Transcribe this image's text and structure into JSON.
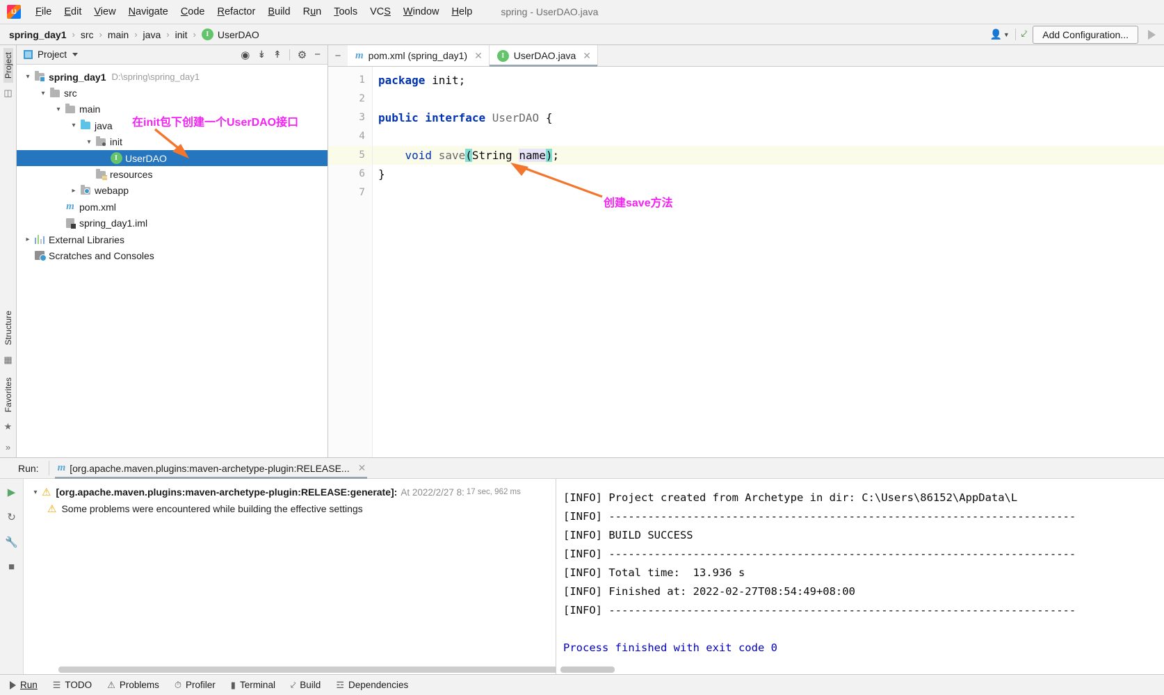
{
  "window": {
    "title": "spring - UserDAO.java",
    "app_icon": "intellij-idea-logo"
  },
  "menubar": {
    "items": [
      {
        "label": "File",
        "mnemonic": "F"
      },
      {
        "label": "Edit",
        "mnemonic": "E"
      },
      {
        "label": "View",
        "mnemonic": "V"
      },
      {
        "label": "Navigate",
        "mnemonic": "N"
      },
      {
        "label": "Code",
        "mnemonic": "C"
      },
      {
        "label": "Refactor",
        "mnemonic": "R"
      },
      {
        "label": "Build",
        "mnemonic": "B"
      },
      {
        "label": "Run",
        "mnemonic": "u"
      },
      {
        "label": "Tools",
        "mnemonic": "T"
      },
      {
        "label": "VCS",
        "mnemonic": "S"
      },
      {
        "label": "Window",
        "mnemonic": "W"
      },
      {
        "label": "Help",
        "mnemonic": "H"
      }
    ]
  },
  "navbar": {
    "breadcrumbs": [
      {
        "label": "spring_day1",
        "bold": true,
        "icon": ""
      },
      {
        "label": "src",
        "bold": false,
        "icon": ""
      },
      {
        "label": "main",
        "bold": false,
        "icon": ""
      },
      {
        "label": "java",
        "bold": false,
        "icon": ""
      },
      {
        "label": "init",
        "bold": false,
        "icon": ""
      },
      {
        "label": "UserDAO",
        "bold": false,
        "icon": "interface-icon"
      }
    ],
    "separator": "›",
    "add_configuration_label": "Add Configuration...",
    "icons": [
      "user-profile-icon",
      "chevron-down-icon",
      "build-hammer-icon",
      "run-play-icon"
    ]
  },
  "left_strip": {
    "top_tabs": [
      {
        "label": "Project",
        "selected": true
      }
    ],
    "bottom_tabs": [
      {
        "label": "Structure"
      },
      {
        "label": "Favorites"
      }
    ],
    "icons": [
      "project-icon",
      "structure-icon",
      "eye-icon",
      "camera-icon",
      "bookmark-icon",
      "enter-icon",
      "star-icon",
      "expand-more-icon"
    ]
  },
  "project_panel": {
    "title": "Project",
    "header_icons": [
      "locate-target-icon",
      "expand-all-icon",
      "collapse-all-icon",
      "settings-gear-icon",
      "hide-minus-icon"
    ],
    "tree": [
      {
        "depth": 0,
        "chevron": "down",
        "icon": "module-folder-icon",
        "label": "spring_day1",
        "bold": true,
        "hint": "D:\\spring\\spring_day1",
        "selected": false
      },
      {
        "depth": 1,
        "chevron": "down",
        "icon": "folder-icon",
        "label": "src",
        "bold": false,
        "hint": "",
        "selected": false
      },
      {
        "depth": 2,
        "chevron": "down",
        "icon": "folder-icon",
        "label": "main",
        "bold": false,
        "hint": "",
        "selected": false
      },
      {
        "depth": 3,
        "chevron": "down",
        "icon": "source-folder-icon",
        "label": "java",
        "bold": false,
        "hint": "",
        "selected": false
      },
      {
        "depth": 4,
        "chevron": "down",
        "icon": "package-folder-icon",
        "label": "init",
        "bold": false,
        "hint": "",
        "selected": false
      },
      {
        "depth": 5,
        "chevron": "none",
        "icon": "interface-icon",
        "label": "UserDAO",
        "bold": false,
        "hint": "",
        "selected": true
      },
      {
        "depth": 4,
        "chevron": "none",
        "icon": "resources-folder-icon",
        "label": "resources",
        "bold": false,
        "hint": "",
        "selected": false
      },
      {
        "depth": 3,
        "chevron": "right",
        "icon": "webapp-folder-icon",
        "label": "webapp",
        "bold": false,
        "hint": "",
        "selected": false
      },
      {
        "depth": 2,
        "chevron": "none",
        "icon": "maven-icon",
        "label": "pom.xml",
        "bold": false,
        "hint": "",
        "selected": false
      },
      {
        "depth": 2,
        "chevron": "none",
        "icon": "iml-file-icon",
        "label": "spring_day1.iml",
        "bold": false,
        "hint": "",
        "selected": false
      },
      {
        "depth": 0,
        "chevron": "right",
        "icon": "libraries-icon",
        "label": "External Libraries",
        "bold": false,
        "hint": "",
        "selected": false
      },
      {
        "depth": 0,
        "chevron": "none",
        "icon": "scratches-icon",
        "label": "Scratches and Consoles",
        "bold": false,
        "hint": "",
        "selected": false
      }
    ]
  },
  "editor": {
    "tabs": [
      {
        "label": "pom.xml (spring_day1)",
        "icon": "maven-icon",
        "active": false,
        "close": "×"
      },
      {
        "label": "UserDAO.java",
        "icon": "interface-icon",
        "active": true,
        "close": "×"
      }
    ],
    "line_numbers": [
      "1",
      "2",
      "3",
      "4",
      "5",
      "6",
      "7"
    ],
    "highlighted_line": 5,
    "code_lines": [
      {
        "n": 1,
        "text": "package init;"
      },
      {
        "n": 2,
        "text": ""
      },
      {
        "n": 3,
        "text": "public interface UserDAO {"
      },
      {
        "n": 4,
        "text": ""
      },
      {
        "n": 5,
        "text": "    void save(String name);"
      },
      {
        "n": 6,
        "text": "}"
      },
      {
        "n": 7,
        "text": ""
      }
    ],
    "annotations": [
      {
        "text": "在init包下创建一个UserDAO接口",
        "color": "#f522f5",
        "arrow": "orange-arrow-down-left"
      },
      {
        "text": "创建save方法",
        "color": "#f522f5",
        "arrow": "orange-arrow-up-left"
      }
    ],
    "annotation_arrow_color": "#f2762e"
  },
  "run_panel": {
    "label": "Run:",
    "tab": {
      "label": "[org.apache.maven.plugins:maven-archetype-plugin:RELEASE...",
      "icon": "maven-icon",
      "close": "×"
    },
    "gutter_icons": [
      "run-play-icon",
      "rerun-icon",
      "wrench-icon",
      "stop-icon"
    ],
    "tree": [
      {
        "chevron": "down",
        "icon": "warning-icon",
        "title": "[org.apache.maven.plugins:maven-archetype-plugin:RELEASE:generate]:",
        "meta": "At 2022/2/27 8:",
        "meta2": "17 sec, 962 ms"
      },
      {
        "chevron": "none",
        "icon": "warning-icon",
        "title": "Some problems were encountered while building the effective settings",
        "meta": "",
        "meta2": ""
      }
    ],
    "console_lines": [
      {
        "text": "[INFO] Project created from Archetype in dir: C:\\Users\\86152\\AppData\\L",
        "style": "normal"
      },
      {
        "text": "[INFO] ------------------------------------------------------------------------",
        "style": "normal"
      },
      {
        "text": "[INFO] BUILD SUCCESS",
        "style": "normal"
      },
      {
        "text": "[INFO] ------------------------------------------------------------------------",
        "style": "normal"
      },
      {
        "text": "[INFO] Total time:  13.936 s",
        "style": "normal"
      },
      {
        "text": "[INFO] Finished at: 2022-02-27T08:54:49+08:00",
        "style": "normal"
      },
      {
        "text": "[INFO] ------------------------------------------------------------------------",
        "style": "normal"
      },
      {
        "text": "",
        "style": "normal"
      },
      {
        "text": "Process finished with exit code 0",
        "style": "blue"
      }
    ]
  },
  "statusbar": {
    "items": [
      {
        "label": "Run",
        "icon": "run-play-icon"
      },
      {
        "label": "TODO",
        "icon": "todo-list-icon"
      },
      {
        "label": "Problems",
        "icon": "problems-icon"
      },
      {
        "label": "Profiler",
        "icon": "profiler-icon"
      },
      {
        "label": "Terminal",
        "icon": "terminal-icon"
      },
      {
        "label": "Build",
        "icon": "build-hammer-icon"
      },
      {
        "label": "Dependencies",
        "icon": "dependencies-icon"
      }
    ]
  },
  "colors": {
    "selection_blue": "#2675bf",
    "annotation_magenta": "#f522f5",
    "arrow_orange": "#f2762e",
    "keyword_blue": "#0033b3",
    "console_blue": "#0000c0",
    "warning_yellow": "#edab00",
    "interface_green": "#63c46b",
    "highlight_line": "#fbfbe9"
  }
}
